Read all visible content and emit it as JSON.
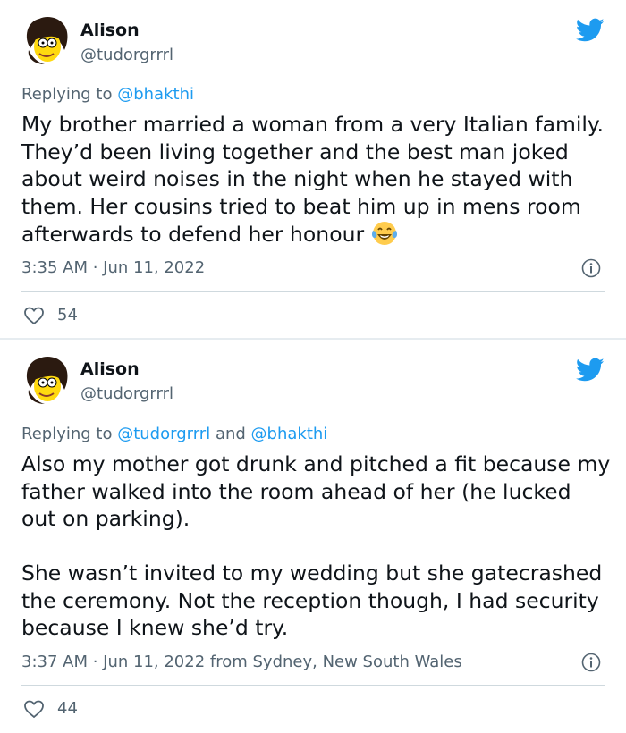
{
  "tweets": [
    {
      "author_name": "Alison",
      "author_handle": "@tudorgrrrl",
      "replying_prefix": "Replying to",
      "replying_to": "@bhakthi",
      "body": "My brother married a woman from a very Italian family. They’d been living together and the best man joked about weird noises in the night when he stayed with them. Her cousins tried to beat him up in mens room afterwards to defend her honour",
      "timestamp": "3:35 AM · Jun 11, 2022",
      "likes": "54",
      "icons": [
        "avatar",
        "twitter-bird-icon",
        "laughing-crying-emoji-icon",
        "info-icon",
        "heart-icon"
      ]
    },
    {
      "author_name": "Alison",
      "author_handle": "@tudorgrrrl",
      "replying_prefix": "Replying to",
      "replying_to": "@tudorgrrrl",
      "replying_and": "and",
      "replying_to_2": "@bhakthi",
      "body_p1": "Also my mother got drunk and pitched a fit because my father walked into the room ahead of her (he lucked out on parking).",
      "body_p2": "She wasn’t invited to my wedding but she gatecrashed the ceremony. Not the reception though, I had security because I knew she’d try.",
      "timestamp": "3:37 AM · Jun 11, 2022 from Sydney, New South Wales",
      "likes": "44",
      "icons": [
        "avatar",
        "twitter-bird-icon",
        "info-icon",
        "heart-icon"
      ]
    }
  ],
  "colors": {
    "text": "#0f1419",
    "secondary": "#536471",
    "link": "#1d9bf0",
    "divider": "#cfd9de",
    "background": "#e6ecf0"
  }
}
